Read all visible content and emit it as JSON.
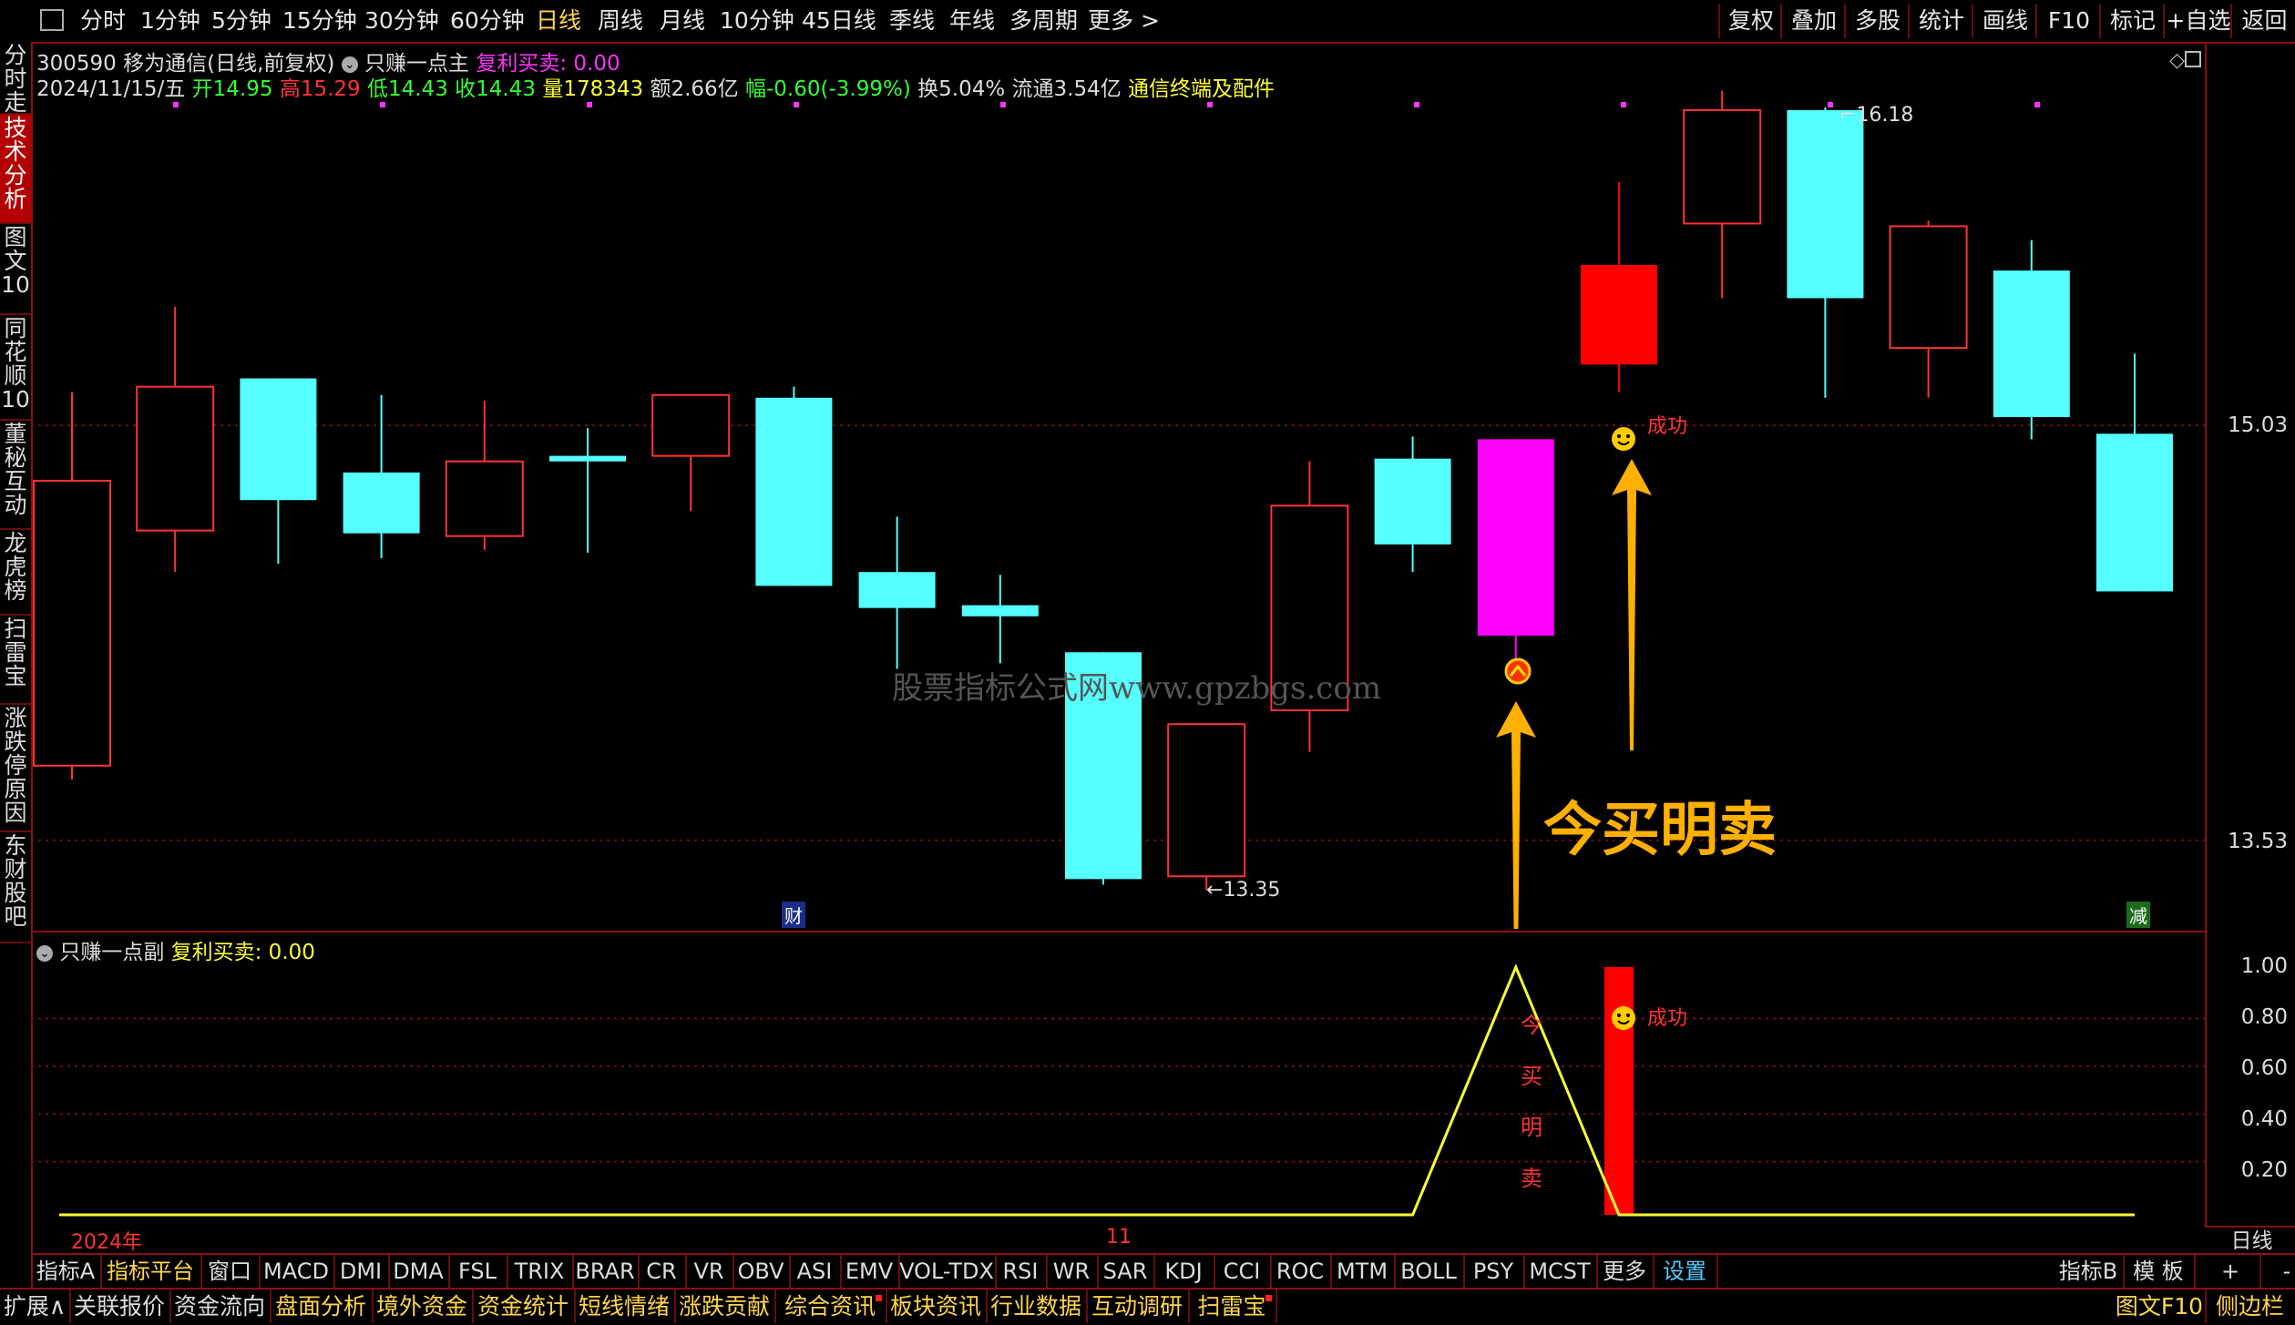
{
  "topbar": {
    "periods": [
      "分时",
      "1分钟",
      "5分钟",
      "15分钟",
      "30分钟",
      "60分钟",
      "日线",
      "周线",
      "月线",
      "10分钟",
      "45日线",
      "季线",
      "年线",
      "多周期",
      "更多 >"
    ],
    "active_period": "日线",
    "right_buttons": [
      "复权",
      "叠加",
      "多股",
      "统计",
      "画线",
      "F10",
      "标记",
      "+自选",
      "返回"
    ]
  },
  "sidebar": {
    "items": [
      "分时走势",
      "技术分析",
      "图文10",
      "同花顺10",
      "董秘互动",
      "龙虎榜",
      "扫雷宝",
      "涨跌停原因",
      "东财股吧"
    ],
    "active": "技术分析"
  },
  "main": {
    "stock_code": "300590",
    "stock_name": "移为通信(日线,前复权)",
    "indicator_name": "只赚一点主",
    "indicator_value": "复利买卖: 0.00",
    "date": "2024/11/15/五",
    "open": "开14.95",
    "high": "高15.29",
    "low": "低14.43",
    "close": "收14.43",
    "volume": "量178343",
    "amount": "额2.66亿",
    "change": "幅-0.60(-3.99%)",
    "turnover": "换5.04%",
    "float": "流通3.54亿",
    "sector": "通信终端及配件",
    "max_label": "16.18",
    "min_label": "13.35",
    "success_label": "成功",
    "annotation": "今买明卖",
    "watermark": "股票指标公式网www.gpzbgs.com",
    "event_cai": "财",
    "event_jian": "减"
  },
  "sub": {
    "indicator_name": "只赚一点副",
    "indicator_value": "复利买卖: 0.00",
    "success_label": "成功",
    "vertical_text": "今买明卖",
    "year_label": "2024年",
    "month_label": "11",
    "period_label": "日线"
  },
  "yaxis": {
    "main": [
      "15.03",
      "13.53"
    ],
    "sub": [
      "1.00",
      "0.80",
      "0.60",
      "0.40",
      "0.20"
    ]
  },
  "tabs1": [
    "指标A",
    "指标平台",
    "窗口",
    "MACD",
    "DMI",
    "DMA",
    "FSL",
    "TRIX",
    "BRAR",
    "CR",
    "VR",
    "OBV",
    "ASI",
    "EMV",
    "VOL-TDX",
    "RSI",
    "WR",
    "SAR",
    "KDJ",
    "CCI",
    "ROC",
    "MTM",
    "BOLL",
    "PSY",
    "MCST",
    "更多",
    "设置"
  ],
  "tabs1_right": [
    "指标B",
    "模 板",
    "+",
    "-"
  ],
  "tabs2": [
    "扩展∧",
    "关联报价",
    "资金流向",
    "盘面分析",
    "境外资金",
    "资金统计",
    "短线情绪",
    "涨跌贡献",
    "综合资讯",
    "板块资讯",
    "行业数据",
    "互动调研",
    "扫雷宝"
  ],
  "tabs2_right": [
    "图文F10",
    "侧边栏"
  ],
  "chart_data": {
    "type": "candlestick",
    "candles": [
      {
        "o": 13.8,
        "c": 14.83,
        "h": 15.15,
        "l": 13.75,
        "color": "red"
      },
      {
        "o": 14.65,
        "c": 15.17,
        "h": 15.46,
        "l": 14.5,
        "color": "red"
      },
      {
        "o": 15.2,
        "c": 14.76,
        "h": 15.2,
        "l": 14.53,
        "color": "cyan"
      },
      {
        "o": 14.64,
        "c": 14.86,
        "h": 15.14,
        "l": 14.55,
        "color": "cyan"
      },
      {
        "o": 14.63,
        "c": 14.9,
        "h": 15.12,
        "l": 14.58,
        "color": "red"
      },
      {
        "o": 14.92,
        "c": 14.9,
        "h": 15.02,
        "l": 14.57,
        "color": "cyan"
      },
      {
        "o": 14.92,
        "c": 15.14,
        "h": 15.14,
        "l": 14.72,
        "color": "red"
      },
      {
        "o": 15.13,
        "c": 14.45,
        "h": 15.17,
        "l": 14.45,
        "color": "cyan"
      },
      {
        "o": 14.5,
        "c": 14.37,
        "h": 14.7,
        "l": 14.15,
        "color": "cyan"
      },
      {
        "o": 14.38,
        "c": 14.34,
        "h": 14.49,
        "l": 14.17,
        "color": "cyan"
      },
      {
        "o": 14.21,
        "c": 13.39,
        "h": 14.21,
        "l": 13.37,
        "color": "cyan"
      },
      {
        "o": 13.4,
        "c": 13.95,
        "h": 13.95,
        "l": 13.35,
        "color": "red"
      },
      {
        "o": 14.0,
        "c": 14.74,
        "h": 14.9,
        "l": 13.85,
        "color": "red"
      },
      {
        "o": 14.91,
        "c": 14.6,
        "h": 14.99,
        "l": 14.5,
        "color": "cyan"
      },
      {
        "o": 14.27,
        "c": 14.98,
        "h": 14.98,
        "l": 14.12,
        "color": "magenta"
      },
      {
        "o": 15.25,
        "c": 15.61,
        "h": 15.91,
        "l": 15.15,
        "color": "red_fill"
      },
      {
        "o": 15.76,
        "c": 16.17,
        "h": 16.24,
        "l": 15.49,
        "color": "red"
      },
      {
        "o": 16.17,
        "c": 15.49,
        "h": 16.18,
        "l": 15.13,
        "color": "cyan"
      },
      {
        "o": 15.31,
        "c": 15.75,
        "h": 15.77,
        "l": 15.13,
        "color": "red"
      },
      {
        "o": 15.59,
        "c": 15.06,
        "h": 15.7,
        "l": 14.98,
        "color": "cyan"
      },
      {
        "o": 15.0,
        "c": 14.43,
        "h": 15.29,
        "l": 14.43,
        "color": "cyan"
      }
    ],
    "ylim": [
      13.21,
      16.41
    ],
    "sub_line": [
      0,
      0,
      0,
      0,
      0,
      0,
      0,
      0,
      0,
      0,
      0,
      0,
      0,
      0,
      1,
      0,
      0,
      0,
      0,
      0,
      0
    ],
    "sub_bar_index": 15,
    "sub_ylim": [
      0,
      1.0
    ]
  }
}
